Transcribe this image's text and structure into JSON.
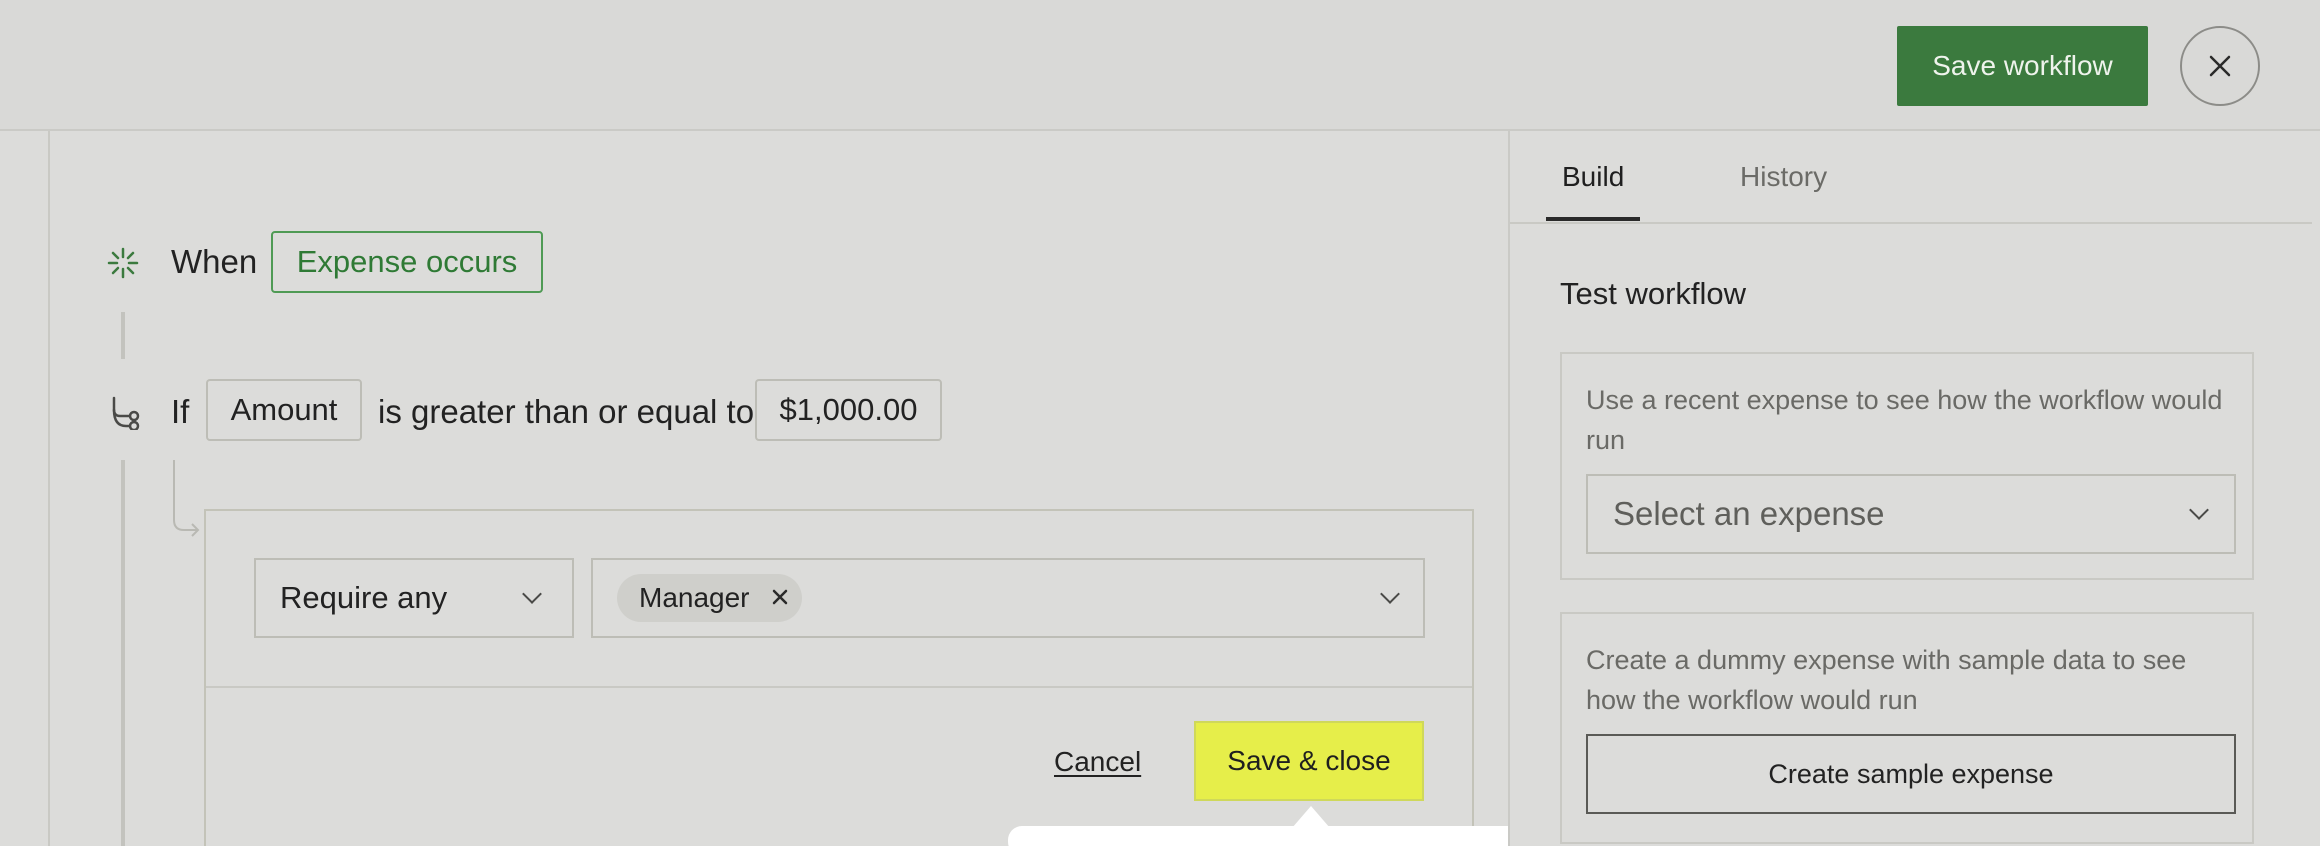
{
  "header": {
    "save_workflow_label": "Save workflow"
  },
  "workflow": {
    "when_label": "When",
    "trigger": "Expense occurs",
    "if_label": "If",
    "condition_field": "Amount",
    "condition_operator": "is greater than or equal to",
    "condition_value": "$1,000.00"
  },
  "approval": {
    "require_mode": "Require any",
    "approvers": [
      "Manager"
    ],
    "cancel_label": "Cancel",
    "save_close_label": "Save & close"
  },
  "side_panel": {
    "tabs": [
      {
        "label": "Build",
        "active": true
      },
      {
        "label": "History",
        "active": false
      }
    ],
    "title": "Test workflow",
    "recent_card": {
      "text": "Use a recent expense to see how the workflow would run",
      "select_placeholder": "Select an expense"
    },
    "dummy_card": {
      "text": "Create a dummy expense with sample data to see how the workflow would run",
      "button_label": "Create sample expense"
    }
  },
  "colors": {
    "primary_green": "#3b7a3e",
    "highlight_yellow": "#e6ee4a",
    "trigger_green": "#2f7a35"
  },
  "icons": [
    "close-icon",
    "trigger-icon",
    "branch-icon",
    "chevron-down-icon",
    "remove-chip-icon"
  ]
}
